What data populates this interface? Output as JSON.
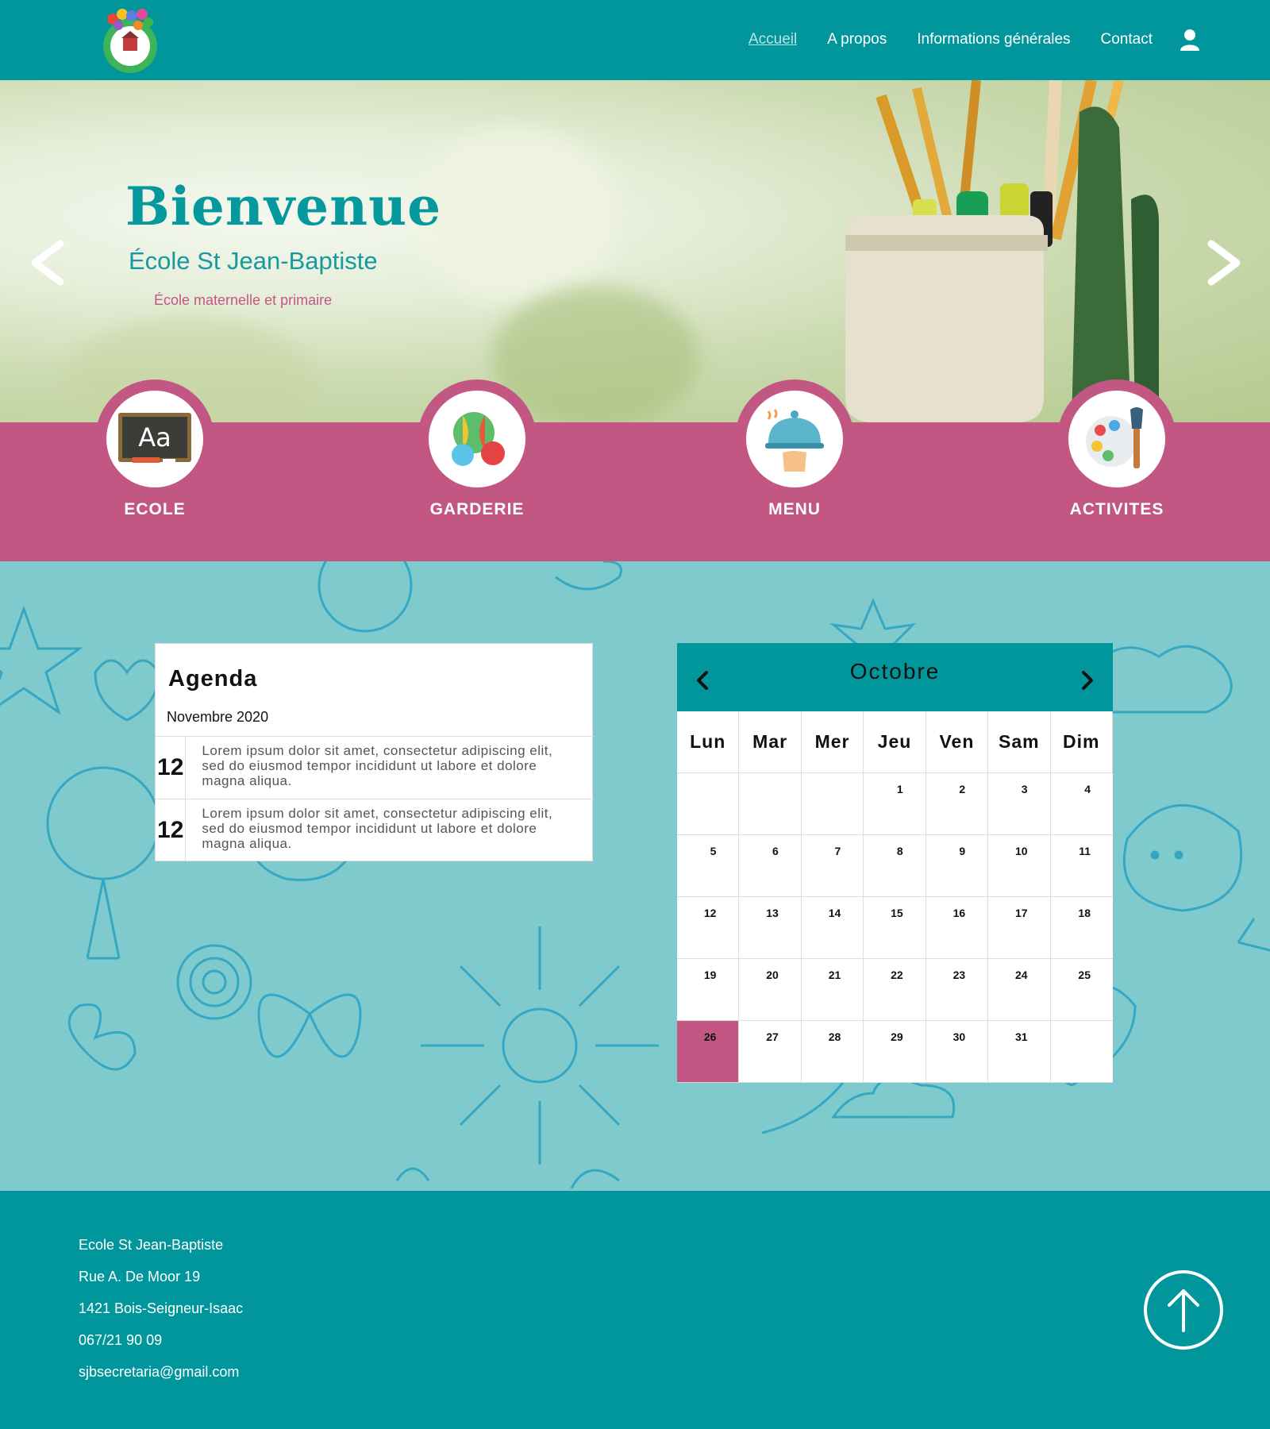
{
  "nav": {
    "items": [
      {
        "label": "Accueil",
        "active": true
      },
      {
        "label": "A propos"
      },
      {
        "label": "Informations générales"
      },
      {
        "label": "Contact"
      }
    ],
    "user_icon": "user-icon"
  },
  "hero": {
    "title": "Bienvenue",
    "subtitle": "École St Jean-Baptiste",
    "tagline": "École maternelle et primaire",
    "prev_icon": "chevron-left-icon",
    "next_icon": "chevron-right-icon"
  },
  "services": [
    {
      "label": "ECOLE",
      "icon": "chalkboard-icon"
    },
    {
      "label": "GARDERIE",
      "icon": "balls-icon"
    },
    {
      "label": "MENU",
      "icon": "cloche-icon"
    },
    {
      "label": "ACTIVITES",
      "icon": "palette-icon"
    }
  ],
  "agenda": {
    "title": "Agenda",
    "month": "Novembre 2020",
    "events": [
      {
        "day": "12",
        "text": "Lorem ipsum dolor sit amet, consectetur adipiscing elit, sed do eiusmod tempor incididunt ut labore et dolore magna aliqua."
      },
      {
        "day": "12",
        "text": "Lorem ipsum dolor sit amet, consectetur adipiscing elit, sed do eiusmod tempor incididunt ut labore et dolore magna aliqua."
      }
    ]
  },
  "calendar": {
    "month": "Octobre",
    "weekdays": [
      "Lun",
      "Mar",
      "Mer",
      "Jeu",
      "Ven",
      "Sam",
      "Dim"
    ],
    "days": [
      "",
      "",
      "",
      "1",
      "2",
      "3",
      "4",
      "5",
      "6",
      "7",
      "8",
      "9",
      "10",
      "11",
      "12",
      "13",
      "14",
      "15",
      "16",
      "17",
      "18",
      "19",
      "20",
      "21",
      "22",
      "23",
      "24",
      "25",
      "26",
      "27",
      "28",
      "29",
      "30",
      "31",
      ""
    ],
    "today": "26"
  },
  "footer": {
    "lines": [
      "Ecole St Jean-Baptiste",
      "Rue A. De Moor 19",
      "1421 Bois-Seigneur-Isaac",
      "067/21 90 09",
      "sjbsecretaria@gmail.com"
    ],
    "up_icon": "arrow-up-icon"
  },
  "colors": {
    "teal": "#01969c",
    "pink": "#c25783",
    "light_teal": "#7fcacd"
  }
}
